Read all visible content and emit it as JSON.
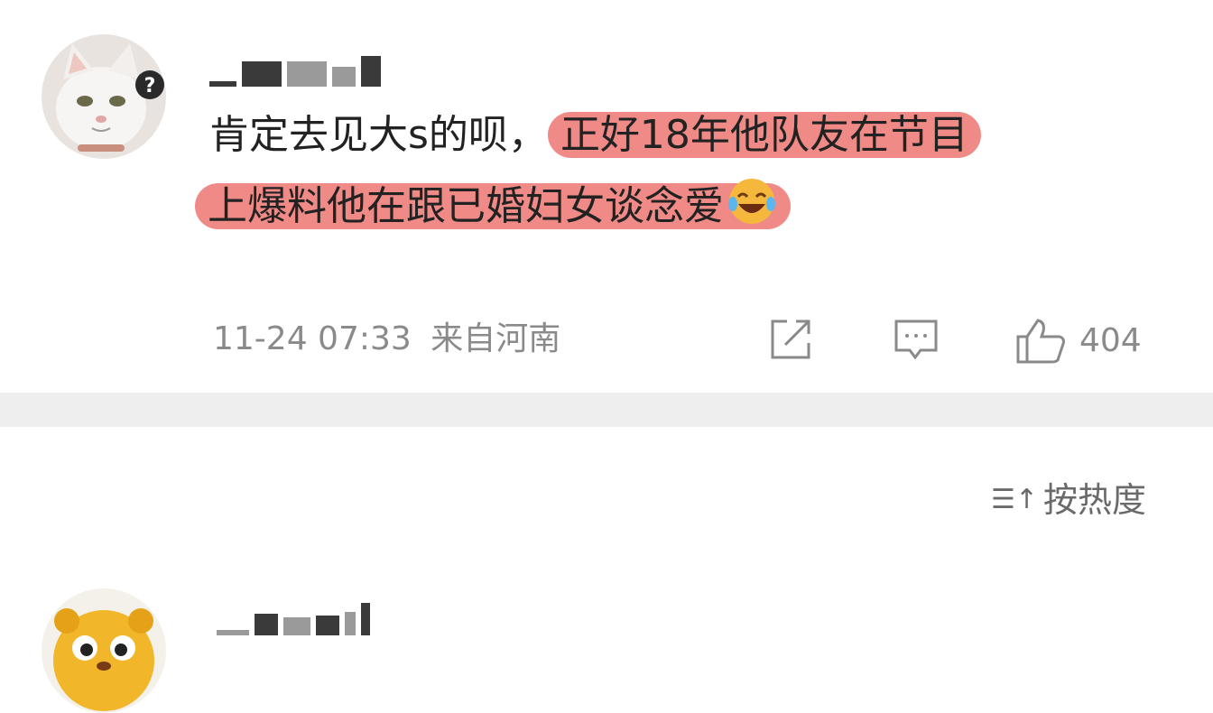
{
  "comment1": {
    "username_obscured": true,
    "text_plain": "肯定去见大s的呗，",
    "text_highlight_1": "正好18年他队友在节目",
    "text_highlight_2": "上爆料他在跟已婚妇女谈念爱",
    "emoji": "laughing-tears-emoji",
    "time": "11-24 07:33",
    "location": "来自河南",
    "likes": "404"
  },
  "sort": {
    "label": "按热度",
    "icon": "sort-icon"
  },
  "comment2": {
    "username_obscured": true
  },
  "colors": {
    "highlight": "#f08a86",
    "divider": "#eeeeee",
    "meta": "#8a8a8a"
  }
}
